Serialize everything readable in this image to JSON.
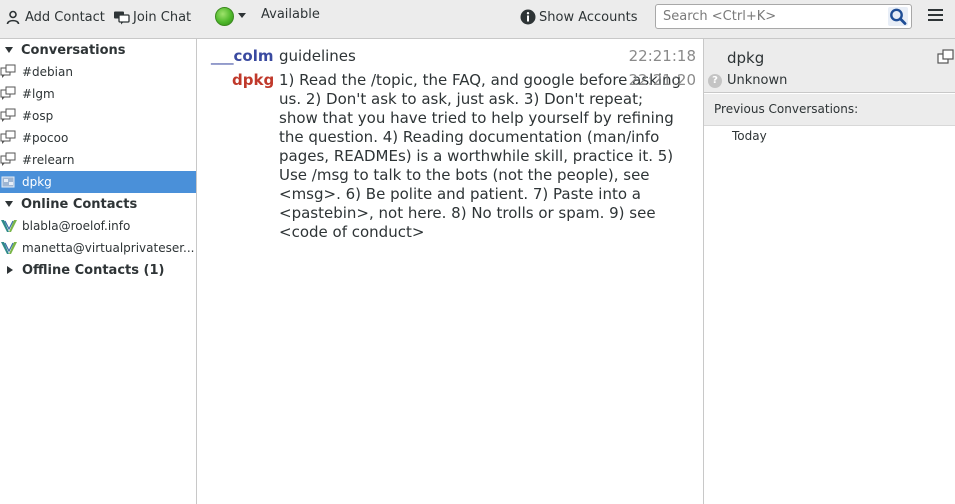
{
  "toolbar": {
    "add_contact": "Add Contact",
    "join_chat": "Join Chat",
    "status": "Available",
    "show_accounts": "Show Accounts",
    "search_placeholder": "Search <Ctrl+K>"
  },
  "sidebar": {
    "groups": {
      "conversations": "Conversations",
      "online": "Online Contacts",
      "offline": "Offline Contacts (1)"
    },
    "conversations": [
      "#debian",
      "#lgm",
      "#osp",
      "#pocoo",
      "#relearn",
      "dpkg"
    ],
    "online_contacts": [
      "blabla@roelof.info",
      "manetta@virtualprivateser..."
    ],
    "selected": "dpkg"
  },
  "conversation": {
    "messages": [
      {
        "nick_prefix": "___",
        "nick": "colm",
        "text": "guidelines",
        "time": "22:21:18"
      },
      {
        "nick": "dpkg",
        "text": "1) Read the /topic, the FAQ, and google before asking us.  2) Don't ask to ask, just ask.  3) Don't repeat; show that you have tried to help yourself by refining the question.  4) Reading documentation (man/info pages, READMEs) is a worthwhile skill, practice it.  5) Use /msg to talk to the bots (not the people), see <msg>.  6) Be polite and patient.  7) Paste into a <pastebin>, not here.  8) No trolls or spam. 9) see <code of conduct>",
        "time": "22:21:20"
      }
    ]
  },
  "contact_panel": {
    "name": "dpkg",
    "status": "Unknown",
    "previous_label": "Previous Conversations:",
    "today": "Today"
  },
  "colors": {
    "selection": "#4a90d9",
    "nick_colm": "#3a4aa0",
    "nick_dpkg": "#c0392b",
    "status_available": "#4fb82b"
  },
  "icons": {
    "add_contact": "add-contact-icon",
    "join_chat": "join-chat-icon",
    "status": "available-status-icon",
    "show_accounts": "info-icon",
    "search": "search-icon",
    "menu": "hamburger-menu-icon",
    "chat_room": "chat-room-icon",
    "contact": "contact-icon",
    "expand": "expand-panel-icon",
    "status_unknown": "unknown-status-icon"
  }
}
